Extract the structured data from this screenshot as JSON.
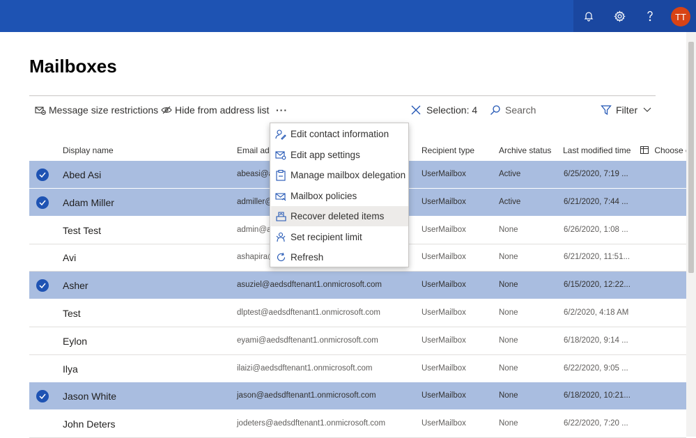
{
  "header": {
    "user_initials": "TT"
  },
  "page": {
    "title": "Mailboxes"
  },
  "commands": {
    "message_size": "Message size restrictions",
    "hide_address": "Hide from address list",
    "more": "···",
    "selection": "Selection: 4",
    "search": "Search",
    "filter": "Filter"
  },
  "columns": {
    "display_name": "Display name",
    "email": "Email add",
    "recipient_type": "Recipient type",
    "archive_status": "Archive status",
    "last_modified": "Last modified time",
    "choose_columns": "Choose co"
  },
  "rows": [
    {
      "name": "Abed Asi",
      "email": "abeasi@a",
      "type": "UserMailbox",
      "archive": "Active",
      "modified": "6/25/2020, 7:19 ...",
      "selected": true
    },
    {
      "name": "Adam Miller",
      "email": "admiller@",
      "type": "UserMailbox",
      "archive": "Active",
      "modified": "6/21/2020, 7:44 ...",
      "selected": true
    },
    {
      "name": "Test Test",
      "email": "admin@a",
      "type": "UserMailbox",
      "archive": "None",
      "modified": "6/26/2020, 1:08 ...",
      "selected": false
    },
    {
      "name": "Avi",
      "email": "ashapira@",
      "type": "UserMailbox",
      "archive": "None",
      "modified": "6/21/2020, 11:51...",
      "selected": false
    },
    {
      "name": "Asher",
      "email": "asuziel@aedsdftenant1.onmicrosoft.com",
      "type": "UserMailbox",
      "archive": "None",
      "modified": "6/15/2020, 12:22...",
      "selected": true
    },
    {
      "name": "Test",
      "email": "dlptest@aedsdftenant1.onmicrosoft.com",
      "type": "UserMailbox",
      "archive": "None",
      "modified": "6/2/2020, 4:18 AM",
      "selected": false
    },
    {
      "name": "Eylon",
      "email": "eyami@aedsdftenant1.onmicrosoft.com",
      "type": "UserMailbox",
      "archive": "None",
      "modified": "6/18/2020, 9:14 ...",
      "selected": false
    },
    {
      "name": "Ilya",
      "email": "ilaizi@aedsdftenant1.onmicrosoft.com",
      "type": "UserMailbox",
      "archive": "None",
      "modified": "6/22/2020, 9:05 ...",
      "selected": false
    },
    {
      "name": "Jason White",
      "email": "jason@aedsdftenant1.onmicrosoft.com",
      "type": "UserMailbox",
      "archive": "None",
      "modified": "6/18/2020, 10:21...",
      "selected": true
    },
    {
      "name": "John Deters",
      "email": "jodeters@aedsdftenant1.onmicrosoft.com",
      "type": "UserMailbox",
      "archive": "None",
      "modified": "6/22/2020, 7:20 ...",
      "selected": false
    }
  ],
  "menu": {
    "items": [
      {
        "label": "Edit contact information",
        "icon": "contact-edit-icon"
      },
      {
        "label": "Edit app settings",
        "icon": "mail-settings-icon"
      },
      {
        "label": "Manage mailbox delegation",
        "icon": "delegation-icon"
      },
      {
        "label": "Mailbox policies",
        "icon": "mail-policy-icon"
      },
      {
        "label": "Recover deleted items",
        "icon": "recover-icon"
      },
      {
        "label": "Set recipient limit",
        "icon": "people-limit-icon"
      },
      {
        "label": "Refresh",
        "icon": "refresh-icon"
      }
    ]
  },
  "colors": {
    "topbar": "#1e53b3",
    "selected_row": "#a9bde0",
    "accent": "#1e53b3",
    "avatar": "#d84315"
  }
}
